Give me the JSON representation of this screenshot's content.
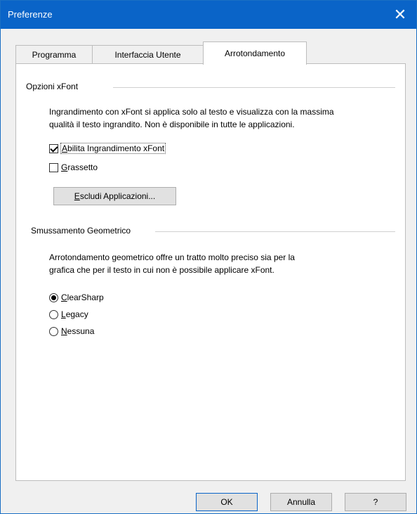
{
  "window": {
    "title": "Preferenze",
    "close_label": "✕"
  },
  "tabs": [
    {
      "label": "Programma",
      "active": false
    },
    {
      "label": "Interfaccia Utente",
      "active": false
    },
    {
      "label": "Arrotondamento",
      "active": true
    }
  ],
  "xfont": {
    "group_label": "Opzioni xFont",
    "description_line1": "Ingrandimento con xFont si applica solo al testo e visualizza con la massima",
    "description_line2": "qualità il testo ingrandito. Non è disponibile in tutte le applicazioni.",
    "enable": {
      "mnemonic": "A",
      "rest": "bilita Ingrandimento xFont",
      "checked": true
    },
    "bold": {
      "mnemonic": "G",
      "rest": "rassetto",
      "checked": false
    },
    "exclude_button": {
      "mnemonic": "E",
      "rest": "scludi Applicazioni..."
    }
  },
  "smoothing": {
    "group_label": "Smussamento Geometrico",
    "description_line1": "Arrotondamento geometrico offre un tratto molto preciso sia per la",
    "description_line2": "grafica che per il testo in cui non è possibile applicare xFont.",
    "options": [
      {
        "mnemonic": "C",
        "rest": "learSharp",
        "selected": true
      },
      {
        "mnemonic": "L",
        "rest": "egacy",
        "selected": false
      },
      {
        "mnemonic": "N",
        "rest": "essuna",
        "selected": false
      }
    ]
  },
  "footer": {
    "ok_label": "OK",
    "cancel_label": "Annulla",
    "help_label": "?"
  }
}
